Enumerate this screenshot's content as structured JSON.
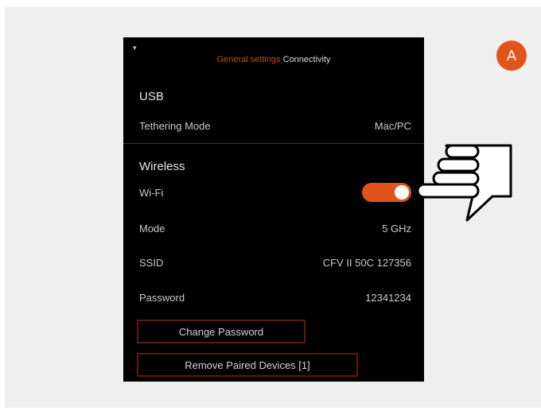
{
  "breadcrumb": {
    "parent": "General settings",
    "current": "Connectivity"
  },
  "usb": {
    "section_title": "USB",
    "tethering_label": "Tethering Mode",
    "tethering_value": "Mac/PC"
  },
  "wireless": {
    "section_title": "Wireless",
    "wifi_label": "Wi-Fi",
    "wifi_enabled": true,
    "mode_label": "Mode",
    "mode_value": "5 GHz",
    "ssid_label": "SSID",
    "ssid_value": "CFV II 50C 127356",
    "password_label": "Password",
    "password_value": "12341234"
  },
  "buttons": {
    "change_password": "Change Password",
    "remove_paired": "Remove Paired Devices [1]"
  },
  "callout": {
    "badge_label": "A"
  },
  "colors": {
    "accent": "#e2541b",
    "screen_bg": "#000000",
    "frame_bg": "#efefef"
  },
  "icons": {
    "status": "wifi-icon",
    "pointer": "pointing-hand-icon"
  }
}
